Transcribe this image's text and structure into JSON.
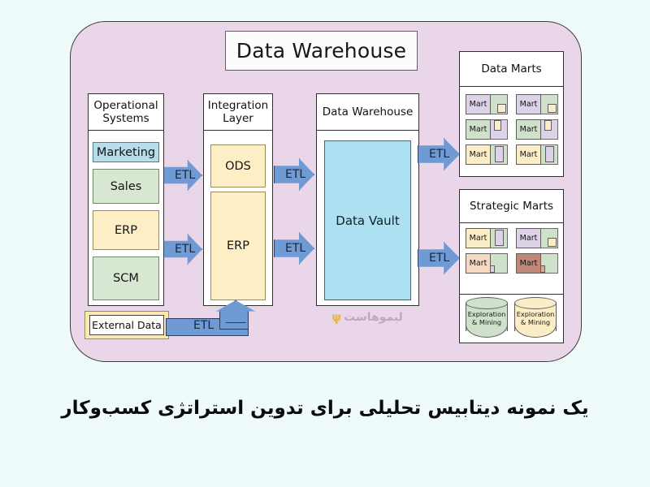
{
  "theme": {
    "page_bg": "#effbfa",
    "canvas_bg": "#e9d6e9",
    "etl_blue": "#6f9ad3",
    "vault_blue": "#ade0f0",
    "tile_blue": "#b7dcea",
    "tile_green": "#d8e7d2",
    "tile_cream": "#fdeec6",
    "mart_purple": "#ddd2e8",
    "mart_green": "#cfe0cb",
    "mart_cream": "#fbeec6",
    "mart_peach": "#f5d9c2",
    "mart_brown": "#c08878"
  },
  "diagram": {
    "title": "Data Warehouse",
    "watermark": {
      "text": "لیموهاست",
      "mark": "ψ"
    }
  },
  "operational": {
    "header": "Operational\nSystems",
    "header_line1": "Operational",
    "header_line2": "Systems",
    "tiles": [
      {
        "label": "Marketing",
        "color": "blue"
      },
      {
        "label": "Sales",
        "color": "green"
      },
      {
        "label": "ERP",
        "color": "cream"
      },
      {
        "label": "SCM",
        "color": "green"
      }
    ]
  },
  "external": {
    "label": "External Data"
  },
  "integration": {
    "header_line1": "Integration",
    "header_line2": "Layer",
    "tiles": [
      {
        "label": "ODS"
      },
      {
        "label": "ERP"
      }
    ]
  },
  "warehouse": {
    "header": "Data Warehouse",
    "vault_label": "Data Vault"
  },
  "data_marts": {
    "header": "Data Marts",
    "cells": [
      {
        "label": "Mart",
        "lblcolor": "#ddd2e8",
        "bgcolor": "#cfe0cb",
        "innercolor": "#fbeec6",
        "inner": "tr"
      },
      {
        "label": "Mart",
        "lblcolor": "#ddd2e8",
        "bgcolor": "#cfe0cb",
        "innercolor": "#fbeec6",
        "inner": "tr"
      },
      {
        "label": "Mart",
        "lblcolor": "#cfe0cb",
        "bgcolor": "#ddd2e8",
        "innercolor": "#fbeec6",
        "inner": "tl"
      },
      {
        "label": "Mart",
        "lblcolor": "#cfe0cb",
        "bgcolor": "#ddd2e8",
        "innercolor": "#fbeec6",
        "inner": "tl"
      },
      {
        "label": "Mart",
        "lblcolor": "#fbeec6",
        "bgcolor": "#cfe0cb",
        "innercolor": "#ddd2e8",
        "inner": "tall"
      },
      {
        "label": "Mart",
        "lblcolor": "#fbeec6",
        "bgcolor": "#cfe0cb",
        "innercolor": "#ddd2e8",
        "inner": "tall"
      }
    ]
  },
  "strategic_marts": {
    "header": "Strategic Marts",
    "cells": [
      {
        "label": "Mart",
        "lblcolor": "#fbeec6",
        "bgcolor": "#cfe0cb",
        "innercolor": "#ddd2e8",
        "inner": "tall"
      },
      {
        "label": "Mart",
        "lblcolor": "#ddd2e8",
        "bgcolor": "#cfe0cb",
        "innercolor": "#fbeec6",
        "inner": "tr"
      },
      {
        "label": "Mart",
        "lblcolor": "#f5d9c2",
        "bgcolor": "#cfe0cb",
        "innercolor": "#ddd2e8",
        "inner": "bot"
      },
      {
        "label": "Mart",
        "lblcolor": "#c08878",
        "bgcolor": "#cfe0cb",
        "innercolor": "#e2a98e",
        "inner": "bot"
      }
    ],
    "cylinders": [
      {
        "line1": "Exploration",
        "line2": "& Mining",
        "color": "#cfe0cb"
      },
      {
        "line1": "Exploration",
        "line2": "& Mining",
        "color": "#fbeec6"
      }
    ]
  },
  "flows": [
    {
      "label": "ETL",
      "id": "ops-to-integration-top"
    },
    {
      "label": "ETL",
      "id": "ops-to-integration-bottom"
    },
    {
      "label": "ETL",
      "id": "integration-to-vault-top"
    },
    {
      "label": "ETL",
      "id": "integration-to-vault-bottom"
    },
    {
      "label": "ETL",
      "id": "vault-to-data-marts"
    },
    {
      "label": "ETL",
      "id": "vault-to-strategic-marts"
    },
    {
      "label": "ETL",
      "id": "external-to-integration"
    }
  ],
  "caption": {
    "text": "یک نمونه دیتابیس تحلیلی برای تدوین استراتژی کسب‌وکار"
  }
}
